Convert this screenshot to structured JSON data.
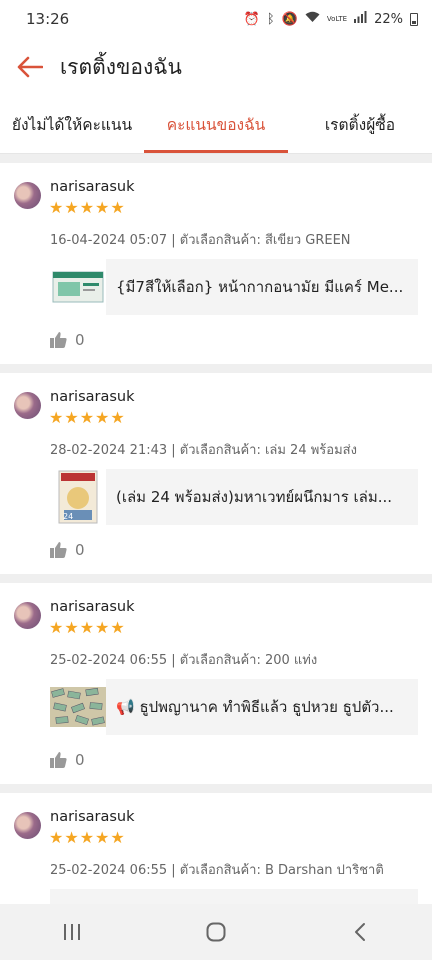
{
  "status": {
    "time": "13:26",
    "battery": "22%",
    "network": "VoLTE"
  },
  "header": {
    "title": "เรตติ้งของฉัน"
  },
  "tabs": [
    {
      "label": "ยังไม่ได้ให้คะแนน",
      "active": false
    },
    {
      "label": "คะแนนของฉัน",
      "active": true
    },
    {
      "label": "เรตติ้งผู้ซื้อ",
      "active": false
    }
  ],
  "reviews": [
    {
      "user": "narisarasuk",
      "stars": 5,
      "meta": "16-04-2024 05:07 | ตัวเลือกสินค้า: สีเขียว GREEN",
      "product": "{มี7สีให้เลือก} หน้ากากอนามัย มีแคร์ Me...",
      "likes": "0"
    },
    {
      "user": "narisarasuk",
      "stars": 5,
      "meta": "28-02-2024 21:43 | ตัวเลือกสินค้า: เล่ม 24 พร้อมส่ง",
      "product": "(เล่ม 24 พร้อมส่ง)มหาเวทย์ผนึกมาร เล่ม...",
      "likes": "0"
    },
    {
      "user": "narisarasuk",
      "stars": 5,
      "meta": "25-02-2024 06:55 | ตัวเลือกสินค้า: 200 แท่ง",
      "product": "📢 ธูปพญานาค ทำพิธีแล้ว ธูปหวย ธูปตัว...",
      "likes": "0"
    },
    {
      "user": "narisarasuk",
      "stars": 5,
      "meta": "25-02-2024 06:55 | ตัวเลือกสินค้า: B Darshan ปาริชาติ",
      "product": "",
      "likes": ""
    }
  ],
  "colors": {
    "accent": "#d9533a",
    "star": "#f5a623"
  }
}
